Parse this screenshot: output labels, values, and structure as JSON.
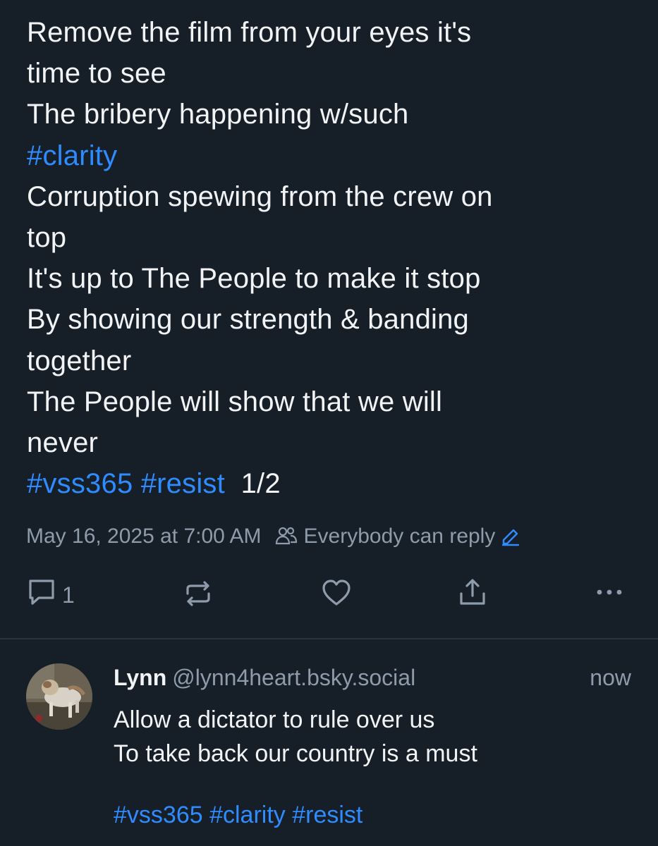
{
  "post": {
    "lines": [
      "Remove the film from your eyes it's",
      "time to see",
      "The bribery happening w/such",
      "#clarity",
      "Corruption spewing from the crew on",
      "top",
      "It's up to The People to make it stop",
      "By showing our strength & banding",
      "together",
      "The People will show that we will",
      "never"
    ],
    "tags": [
      "#vss365",
      "#resist"
    ],
    "thread_counter": "1/2",
    "timestamp": "May 16, 2025 at 7:00 AM",
    "reply_setting": "Everybody can reply",
    "actions": {
      "reply_count": "1"
    },
    "colors": {
      "background": "#161e27",
      "text": "#f1f3f5",
      "muted": "#8e9bab",
      "link": "#2f8cff"
    },
    "icons": [
      "reply-icon",
      "repost-icon",
      "like-icon",
      "share-icon",
      "more-icon",
      "people-icon",
      "edit-icon"
    ]
  },
  "reply": {
    "author": "Lynn",
    "handle": "@lynn4heart.bsky.social",
    "time": "now",
    "lines": [
      "Allow a dictator to rule over us",
      "To take back our country is a must"
    ],
    "tags": "#vss365 #clarity #resist"
  }
}
